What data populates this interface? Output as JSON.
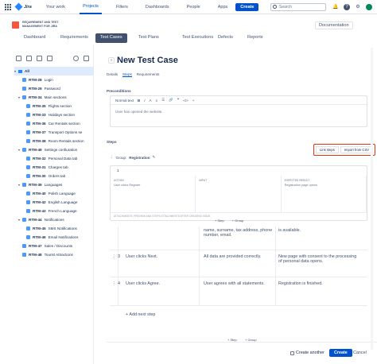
{
  "topbar": {
    "brand": "Jira",
    "nav": [
      "Your work",
      "Projects",
      "Filters",
      "Dashboards",
      "People",
      "Apps"
    ],
    "create": "Create",
    "search_placeholder": "Search"
  },
  "app": {
    "title": "REQUIREMENT AND TEST MANAGEMENT FOR JIRA",
    "documentation": "Documentation",
    "tabs": [
      "Dashboard",
      "Requirements",
      "Test Cases",
      "Test Plans",
      "Test Executions",
      "Defects",
      "Reports"
    ],
    "active_tab": "Test Cases"
  },
  "tree": {
    "root": "All",
    "items": [
      {
        "key": "RTM-28",
        "label": "Login",
        "level": 2,
        "folder": false
      },
      {
        "key": "RTM-29",
        "label": "Password",
        "level": 2,
        "folder": false
      },
      {
        "key": "RTM-34",
        "label": "Main sections",
        "level": 2,
        "folder": true
      },
      {
        "key": "RTM-35",
        "label": "Flights section",
        "level": 3,
        "folder": false
      },
      {
        "key": "RTM-33",
        "label": "Holidays section",
        "level": 3,
        "folder": false
      },
      {
        "key": "RTM-36",
        "label": "Car Rentals section",
        "level": 3,
        "folder": false
      },
      {
        "key": "RTM-37",
        "label": "Transport Options se",
        "level": 3,
        "folder": false
      },
      {
        "key": "RTM-38",
        "label": "Room Rentals section",
        "level": 3,
        "folder": false
      },
      {
        "key": "RTM-49",
        "label": "Settings confiuration",
        "level": 2,
        "folder": true
      },
      {
        "key": "RTM-32",
        "label": "Personal Data tab",
        "level": 3,
        "folder": false
      },
      {
        "key": "RTM-31",
        "label": "Charges tab",
        "level": 3,
        "folder": false
      },
      {
        "key": "RTM-30",
        "label": "Orders tab",
        "level": 3,
        "folder": false
      },
      {
        "key": "RTM-39",
        "label": "Languages",
        "level": 2,
        "folder": true
      },
      {
        "key": "RTM-40",
        "label": "Polish Language",
        "level": 3,
        "folder": false
      },
      {
        "key": "RTM-42",
        "label": "English Language",
        "level": 3,
        "folder": false
      },
      {
        "key": "RTM-43",
        "label": "French Language",
        "level": 3,
        "folder": false
      },
      {
        "key": "RTM-44",
        "label": "Notifications",
        "level": 2,
        "folder": true
      },
      {
        "key": "RTM-45",
        "label": "SMS Notifications",
        "level": 3,
        "folder": false
      },
      {
        "key": "RTM-46",
        "label": "Email Notifications",
        "level": 3,
        "folder": false
      },
      {
        "key": "RTM-47",
        "label": "Sales / Discounts",
        "level": 2,
        "folder": false
      },
      {
        "key": "RTM-48",
        "label": "Tourist Attractions",
        "level": 2,
        "folder": false
      }
    ]
  },
  "form": {
    "title": "New Test Case",
    "subtabs": [
      "Details",
      "Steps",
      "Requirements"
    ],
    "preconditions_label": "Preconditions",
    "editor_style": "Normal text",
    "preconditions_text": "User has opened the website.",
    "steps_label": "Steps",
    "link_steps": "Link steps",
    "import_csv": "Import from CSV",
    "group_label": "Group:",
    "group_name": "Registration",
    "step1_num": "1",
    "col_action": "ACTION",
    "col_input": "INPUT",
    "col_result": "EXPECTED RESULT",
    "step1_action": "User clicks Register",
    "step1_result": "Registration page opens",
    "attachments": "ATTACHMENTS: PREVIEW AND STEPS ATTACHMENTS AFTER CREATING ISSUE",
    "add_step_mini": "+ Step",
    "add_group_mini": "+ Group",
    "rows": [
      {
        "num": "",
        "action": "",
        "input": "name, surname, tax address, phone number, email.",
        "result": "is available."
      },
      {
        "num": "3",
        "action": "User clicks Next.",
        "input": "All data are provided correctly.",
        "result": "New page with consent to the processing of personal data opens."
      },
      {
        "num": "4",
        "action": "User clicks Agree.",
        "input": "User agrees with all statements.",
        "result": "Registration is finished."
      }
    ],
    "add_next_step": "+ Add next step",
    "bottom_step": "+ Step",
    "bottom_group": "+ Group",
    "create_another": "Create another",
    "create": "Create",
    "cancel": "Cancel"
  }
}
